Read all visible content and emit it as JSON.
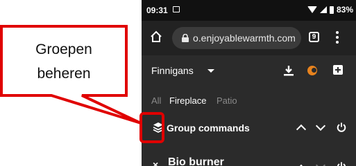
{
  "status_bar": {
    "time": "09:31",
    "battery": "83%"
  },
  "browser": {
    "url": "o.enjoyablewarmth.com",
    "tab_count": "9"
  },
  "app_bar": {
    "site_name": "Finnigans"
  },
  "filters": [
    {
      "label": "All",
      "active": false
    },
    {
      "label": "Fireplace",
      "active": true
    },
    {
      "label": "Patio",
      "active": false
    }
  ],
  "rows": [
    {
      "label": "Group commands",
      "icon": "layers-icon"
    },
    {
      "label": "Bio burner",
      "icon": "close-icon"
    }
  ],
  "callout": {
    "line1": "Groepen",
    "line2": "beheren",
    "color": "#e00000"
  }
}
